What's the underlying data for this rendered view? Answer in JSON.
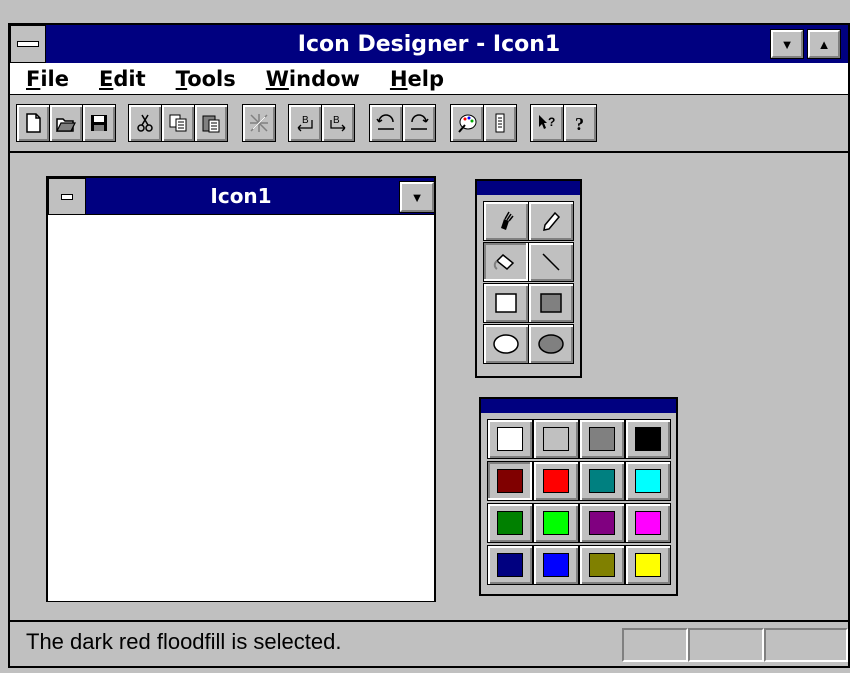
{
  "window": {
    "title": "Icon Designer - Icon1"
  },
  "menu": [
    "File",
    "Edit",
    "Tools",
    "Window",
    "Help"
  ],
  "toolbar": {
    "buttons": [
      "new-icon",
      "open-icon",
      "save-icon",
      "cut-icon",
      "copy-icon",
      "paste-icon",
      "clear-icon",
      "bold-left-icon",
      "bold-right-icon",
      "undo-icon",
      "redo-icon",
      "palette-icon",
      "phone-icon",
      "context-help-icon",
      "help-icon"
    ],
    "bold_label": "B"
  },
  "child_window": {
    "title": "Icon1"
  },
  "tools": [
    "brush-icon",
    "pencil-icon",
    "floodfill-icon",
    "line-icon",
    "rectangle-icon",
    "filled-rectangle-icon",
    "ellipse-icon",
    "filled-ellipse-icon"
  ],
  "colors": [
    "#ffffff",
    "#c0c0c0",
    "#808080",
    "#000000",
    "#800000",
    "#ff0000",
    "#008080",
    "#00ffff",
    "#008000",
    "#00ff00",
    "#800080",
    "#ff00ff",
    "#000080",
    "#0000ff",
    "#808000",
    "#ffff00"
  ],
  "status": {
    "text": "The dark red floodfill is selected."
  }
}
